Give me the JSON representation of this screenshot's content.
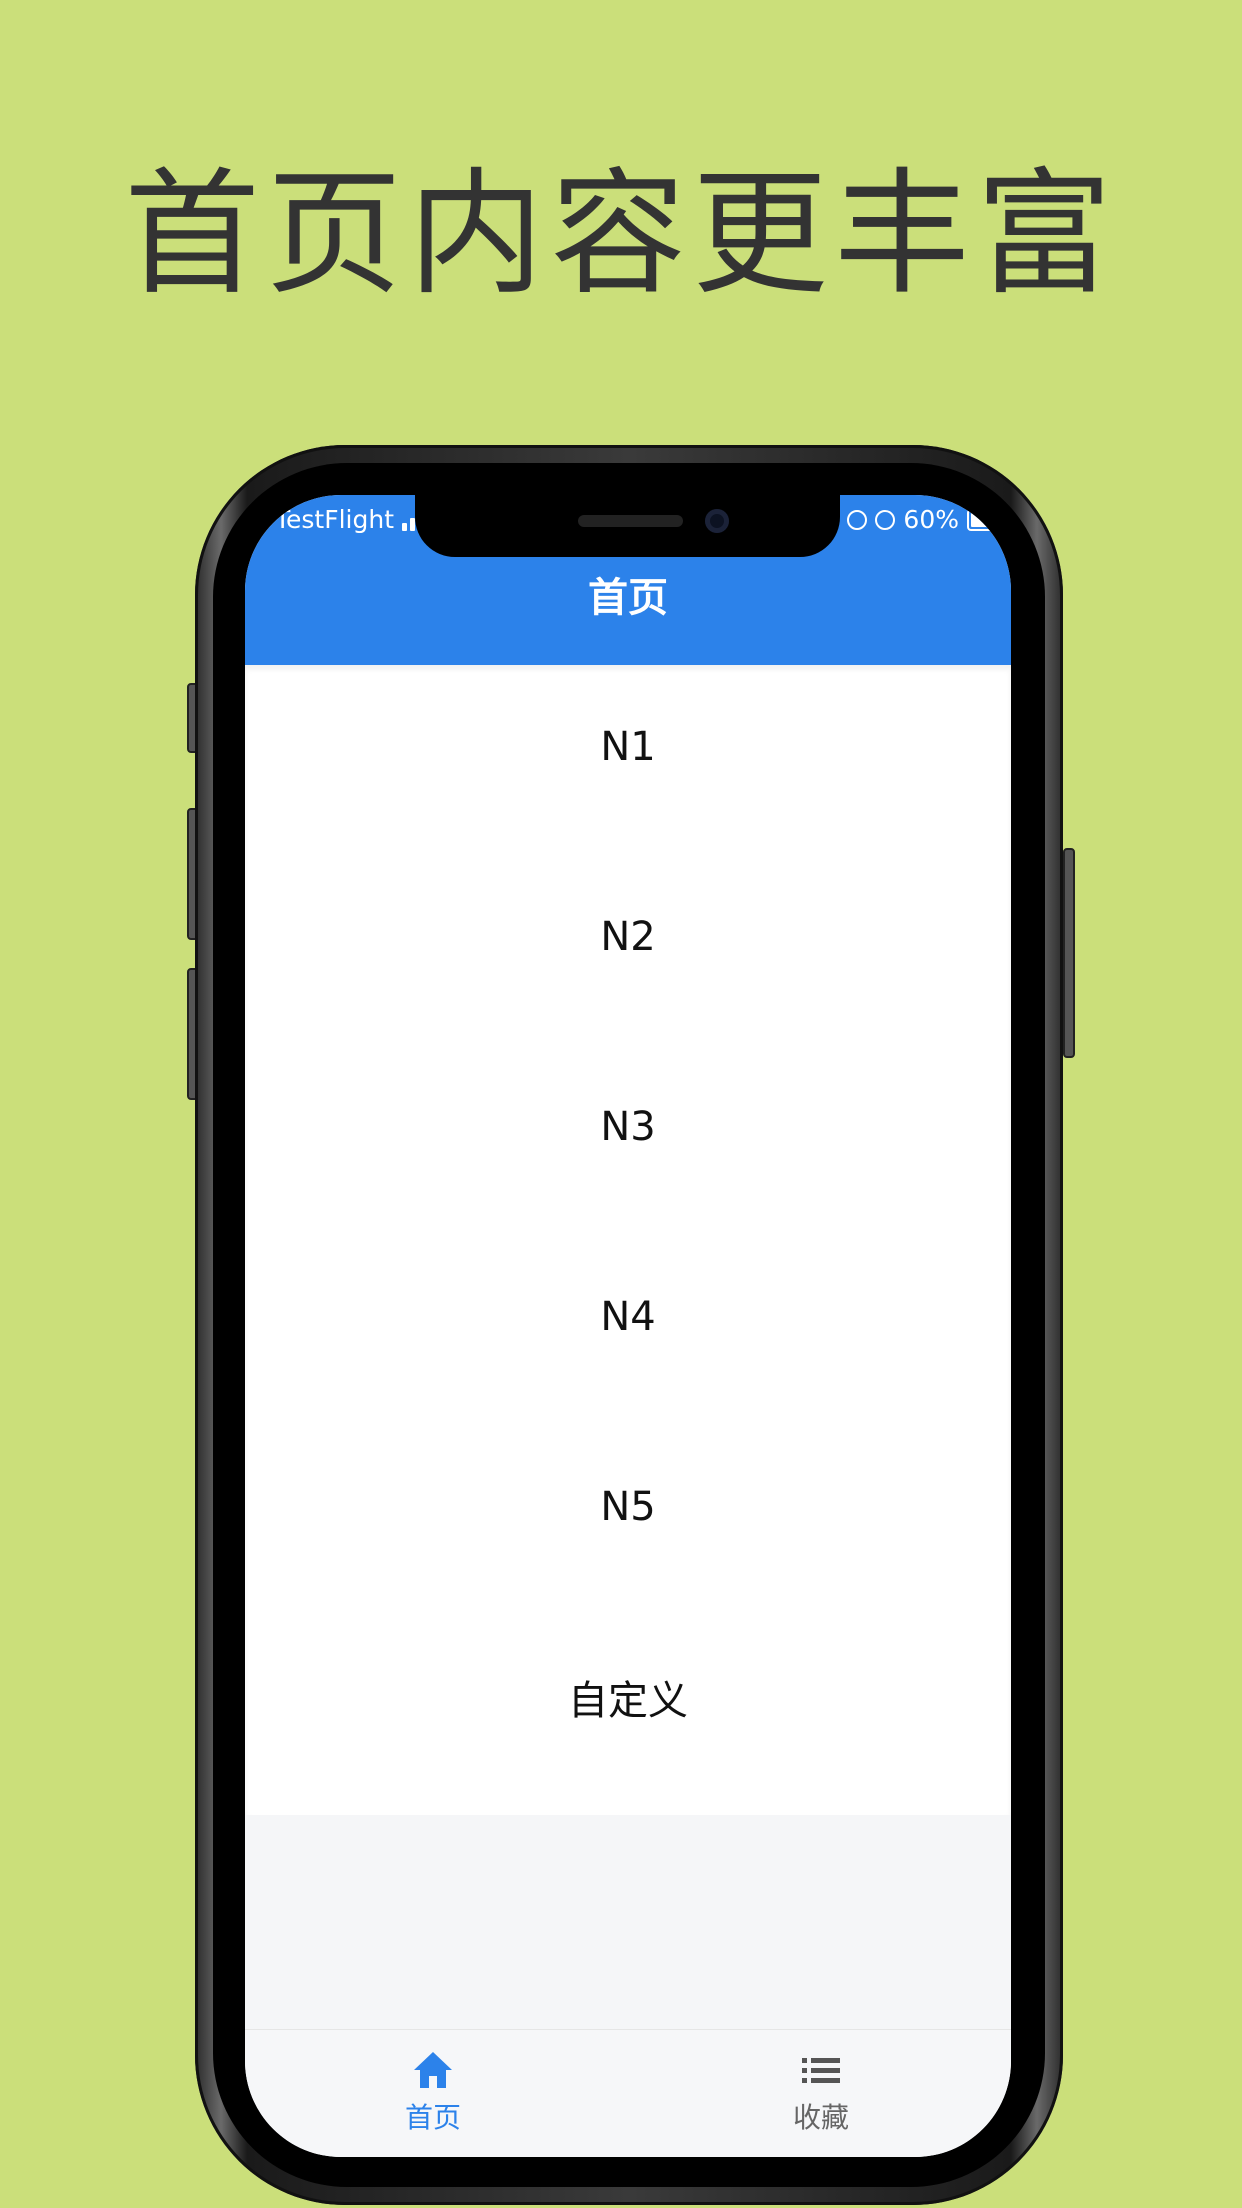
{
  "headline": "首页内容更丰富",
  "status_bar": {
    "carrier": "TestFlight",
    "battery": "60%"
  },
  "nav": {
    "title": "首页"
  },
  "list": {
    "items": [
      "N1",
      "N2",
      "N3",
      "N4",
      "N5",
      "自定义"
    ]
  },
  "tabbar": {
    "home_label": "首页",
    "favorites_label": "收藏"
  },
  "colors": {
    "background": "#cbdf7a",
    "accent": "#2c82ea",
    "tab_inactive": "#666666"
  },
  "icons": {
    "home": "home-icon",
    "favorites": "list-icon"
  }
}
